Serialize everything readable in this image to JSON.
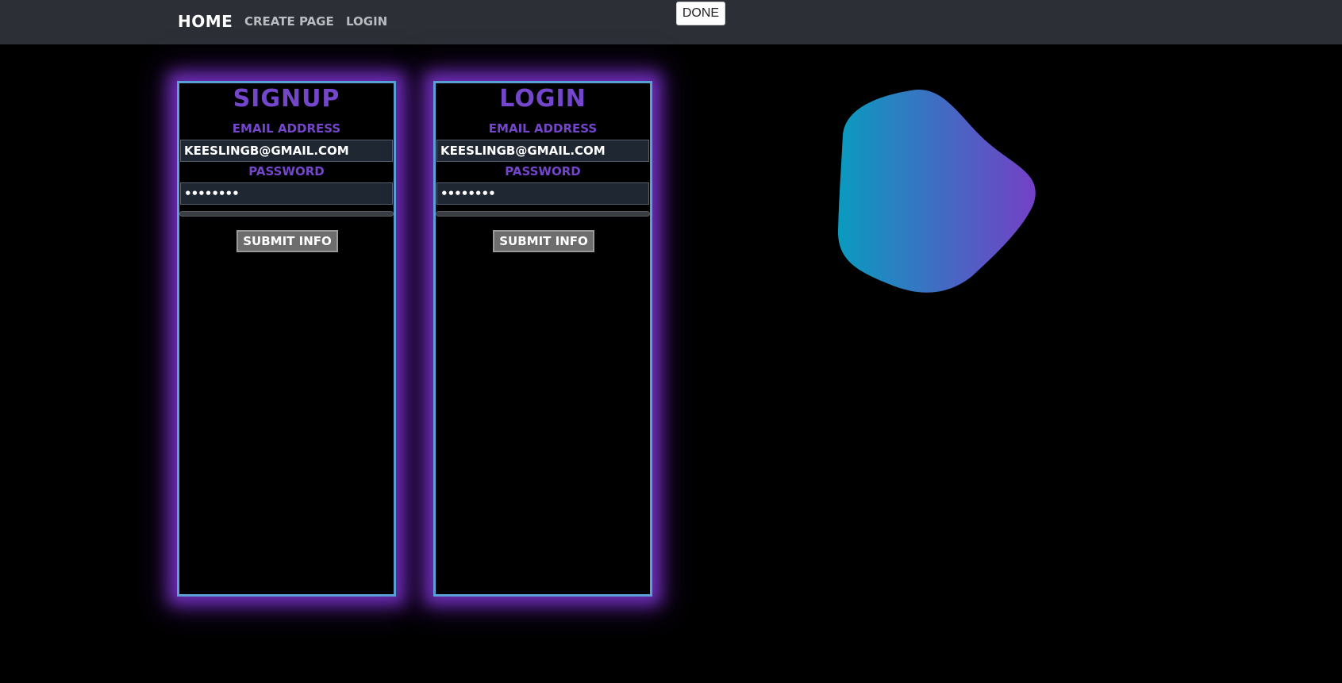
{
  "nav": {
    "brand": "Home",
    "links": [
      "Create Page",
      "Login"
    ]
  },
  "done_button": "DONE",
  "forms": [
    {
      "title": "Signup",
      "email_label": "Email Address",
      "email_value": "keeslingb@gmail.com",
      "password_label": "Password",
      "password_value": "••••••••",
      "submit_label": "Submit Info"
    },
    {
      "title": "Login",
      "email_label": "Email Address",
      "email_value": "keeslingb@gmail.com",
      "password_label": "Password",
      "password_value": "••••••••",
      "submit_label": "Submit Info"
    }
  ],
  "colors": {
    "accent_purple": "#7446cc",
    "panel_border": "#5aa0d6",
    "navbar_bg": "#2c3036",
    "blob_gradient_start": "#0a9bbf",
    "blob_gradient_end": "#7440c6"
  }
}
